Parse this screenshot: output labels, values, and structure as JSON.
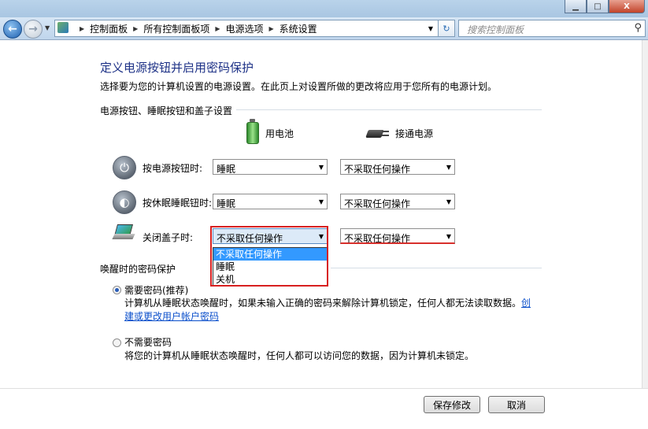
{
  "window": {
    "min_icon": "minimize-icon",
    "max_icon": "maximize-icon",
    "close_label": "X"
  },
  "address": {
    "crumbs": [
      "控制面板",
      "所有控制面板项",
      "电源选项",
      "系统设置"
    ],
    "search_placeholder": "搜索控制面板"
  },
  "page": {
    "title": "定义电源按钮并启用密码保护",
    "description": "选择要为您的计算机设置的电源设置。在此页上对设置所做的更改将应用于您所有的电源计划。"
  },
  "buttons_section": {
    "heading": "电源按钮、睡眠按钮和盖子设置",
    "col_battery": "用电池",
    "col_plugged": "接通电源",
    "rows": [
      {
        "label": "按电源按钮时:",
        "battery": "睡眠",
        "plugged": "不采取任何操作"
      },
      {
        "label": "按休眠睡眠钮时:",
        "battery": "睡眠",
        "plugged": "不采取任何操作"
      },
      {
        "label": "关闭盖子时:",
        "battery": "不采取任何操作",
        "plugged": "不采取任何操作"
      }
    ],
    "dropdown_options": [
      "不采取任何操作",
      "睡眠",
      "关机"
    ]
  },
  "password_section": {
    "heading": "唤醒时的密码保护",
    "require_label": "需要密码(推荐)",
    "require_desc": "计算机从睡眠状态唤醒时，如果未输入正确的密码来解除计算机锁定，任何人都无法读取数据。",
    "require_link": "创建或更改用户帐户密码",
    "norequire_label": "不需要密码",
    "norequire_desc": "将您的计算机从睡眠状态唤醒时，任何人都可以访问您的数据，因为计算机未锁定。"
  },
  "footer": {
    "save": "保存修改",
    "cancel": "取消"
  }
}
